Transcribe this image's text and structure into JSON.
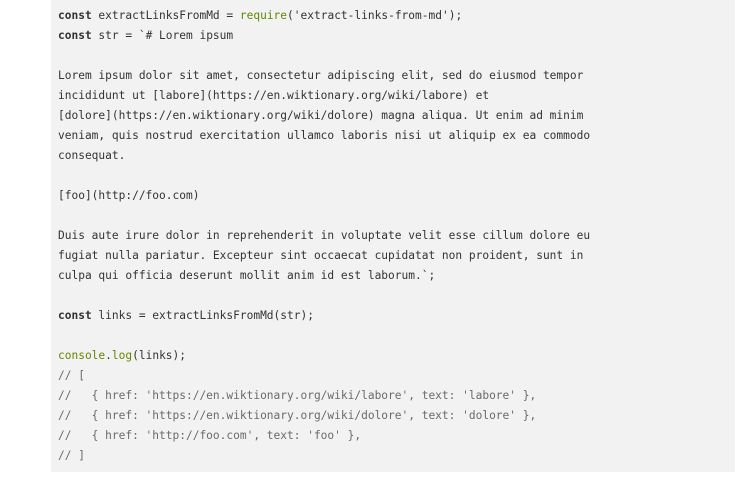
{
  "colors": {
    "code_background": "#f2f2f2",
    "text": "#333333",
    "function_call": "#5f8700",
    "comment": "#6a6a6a"
  },
  "code": {
    "lines": [
      [
        {
          "t": "kw",
          "v": "const"
        },
        {
          "t": "plain",
          "v": " extractLinksFromMd = "
        },
        {
          "t": "fn",
          "v": "require"
        },
        {
          "t": "plain",
          "v": "("
        },
        {
          "t": "str",
          "v": "'extract-links-from-md'"
        },
        {
          "t": "plain",
          "v": ");"
        }
      ],
      [
        {
          "t": "kw",
          "v": "const"
        },
        {
          "t": "plain",
          "v": " str = "
        },
        {
          "t": "str",
          "v": "`# Lorem ipsum"
        }
      ],
      [],
      [
        {
          "t": "str",
          "v": "Lorem ipsum dolor sit amet, consectetur adipiscing elit, sed do eiusmod tempor"
        }
      ],
      [
        {
          "t": "str",
          "v": "incididunt ut [labore](https://en.wiktionary.org/wiki/labore) et"
        }
      ],
      [
        {
          "t": "str",
          "v": "[dolore](https://en.wiktionary.org/wiki/dolore) magna aliqua. Ut enim ad minim"
        }
      ],
      [
        {
          "t": "str",
          "v": "veniam, quis nostrud exercitation ullamco laboris nisi ut aliquip ex ea commodo"
        }
      ],
      [
        {
          "t": "str",
          "v": "consequat."
        }
      ],
      [],
      [
        {
          "t": "str",
          "v": "[foo](http://foo.com)"
        }
      ],
      [],
      [
        {
          "t": "str",
          "v": "Duis aute irure dolor in reprehenderit in voluptate velit esse cillum dolore eu"
        }
      ],
      [
        {
          "t": "str",
          "v": "fugiat nulla pariatur. Excepteur sint occaecat cupidatat non proident, sunt in"
        }
      ],
      [
        {
          "t": "str",
          "v": "culpa qui officia deserunt mollit anim id est laborum.`"
        },
        {
          "t": "plain",
          "v": ";"
        }
      ],
      [],
      [
        {
          "t": "kw",
          "v": "const"
        },
        {
          "t": "plain",
          "v": " links = extractLinksFromMd(str);"
        }
      ],
      [],
      [
        {
          "t": "fn",
          "v": "console"
        },
        {
          "t": "plain",
          "v": "."
        },
        {
          "t": "fn",
          "v": "log"
        },
        {
          "t": "plain",
          "v": "(links);"
        }
      ],
      [
        {
          "t": "cmt",
          "v": "// ["
        }
      ],
      [
        {
          "t": "cmt",
          "v": "//   { href: 'https://en.wiktionary.org/wiki/labore', text: 'labore' },"
        }
      ],
      [
        {
          "t": "cmt",
          "v": "//   { href: 'https://en.wiktionary.org/wiki/dolore', text: 'dolore' },"
        }
      ],
      [
        {
          "t": "cmt",
          "v": "//   { href: 'http://foo.com', text: 'foo' },"
        }
      ],
      [
        {
          "t": "cmt",
          "v": "// ]"
        }
      ]
    ]
  }
}
